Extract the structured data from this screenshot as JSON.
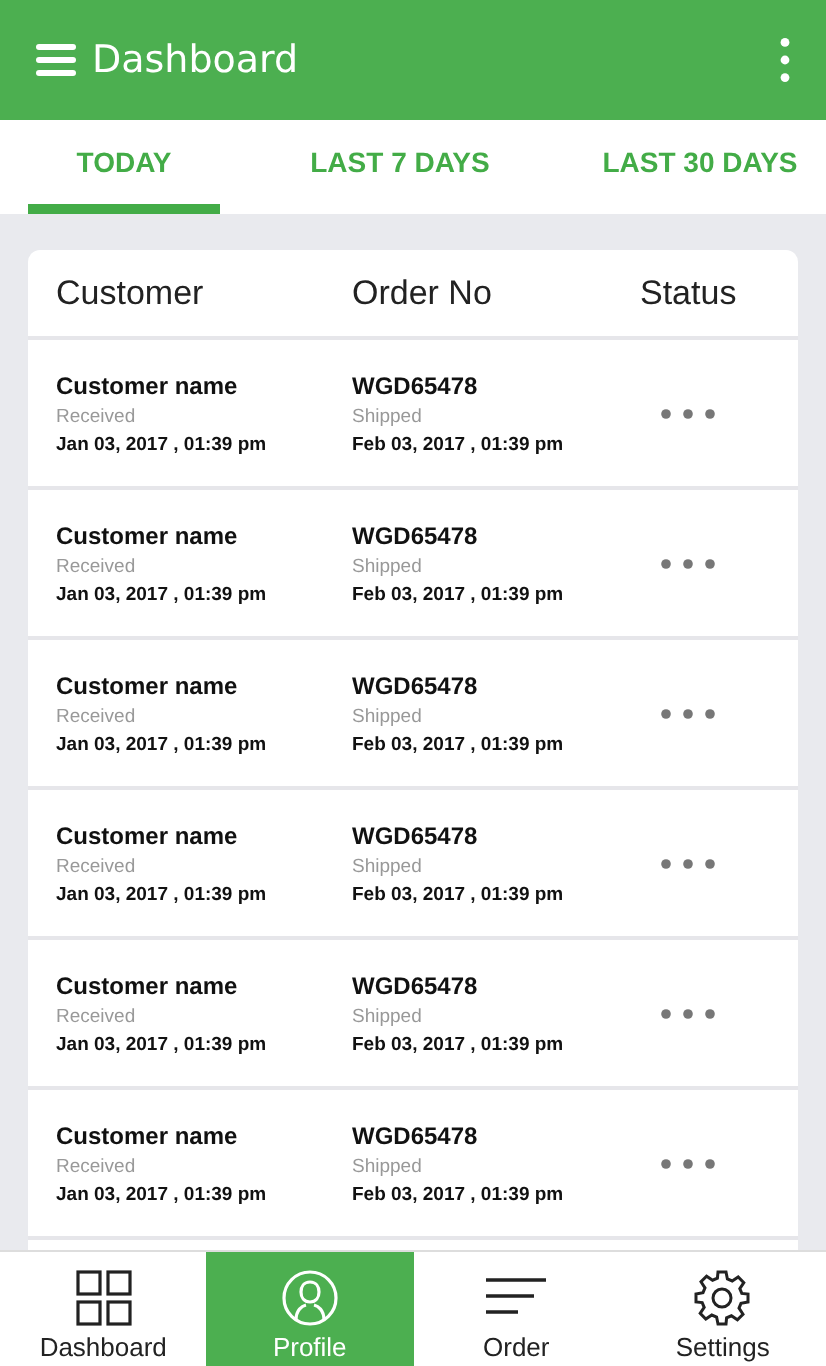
{
  "app_bar": {
    "title": "Dashboard"
  },
  "tabs": [
    {
      "label": "TODAY",
      "selected": true
    },
    {
      "label": "LAST 7 DAYS",
      "selected": false
    },
    {
      "label": "LAST 30 DAYS",
      "selected": false
    }
  ],
  "table": {
    "columns": [
      "Customer",
      "Order No",
      "Status"
    ],
    "rows": [
      {
        "customer": "Customer name",
        "received_label": "Received",
        "received_date": "Jan 03, 2017 , 01:39 pm",
        "order_no": "WGD65478",
        "shipped_label": "Shipped",
        "shipped_date": "Feb 03, 2017 , 01:39 pm"
      },
      {
        "customer": "Customer name",
        "received_label": "Received",
        "received_date": "Jan 03, 2017 , 01:39 pm",
        "order_no": "WGD65478",
        "shipped_label": "Shipped",
        "shipped_date": "Feb 03, 2017 , 01:39 pm"
      },
      {
        "customer": "Customer name",
        "received_label": "Received",
        "received_date": "Jan 03, 2017 , 01:39 pm",
        "order_no": "WGD65478",
        "shipped_label": "Shipped",
        "shipped_date": "Feb 03, 2017 , 01:39 pm"
      },
      {
        "customer": "Customer name",
        "received_label": "Received",
        "received_date": "Jan 03, 2017 , 01:39 pm",
        "order_no": "WGD65478",
        "shipped_label": "Shipped",
        "shipped_date": "Feb 03, 2017 , 01:39 pm"
      },
      {
        "customer": "Customer name",
        "received_label": "Received",
        "received_date": "Jan 03, 2017 , 01:39 pm",
        "order_no": "WGD65478",
        "shipped_label": "Shipped",
        "shipped_date": "Feb 03, 2017 , 01:39 pm"
      },
      {
        "customer": "Customer name",
        "received_label": "Received",
        "received_date": "Jan 03, 2017 , 01:39 pm",
        "order_no": "WGD65478",
        "shipped_label": "Shipped",
        "shipped_date": "Feb 03, 2017 , 01:39 pm"
      }
    ]
  },
  "bottom_nav": [
    {
      "kind": "grid",
      "label": "Dashboard",
      "selected": false
    },
    {
      "kind": "profile",
      "label": "Profile",
      "selected": true
    },
    {
      "kind": "lines",
      "label": "Order",
      "selected": false
    },
    {
      "kind": "gear",
      "label": "Settings",
      "selected": false
    }
  ]
}
